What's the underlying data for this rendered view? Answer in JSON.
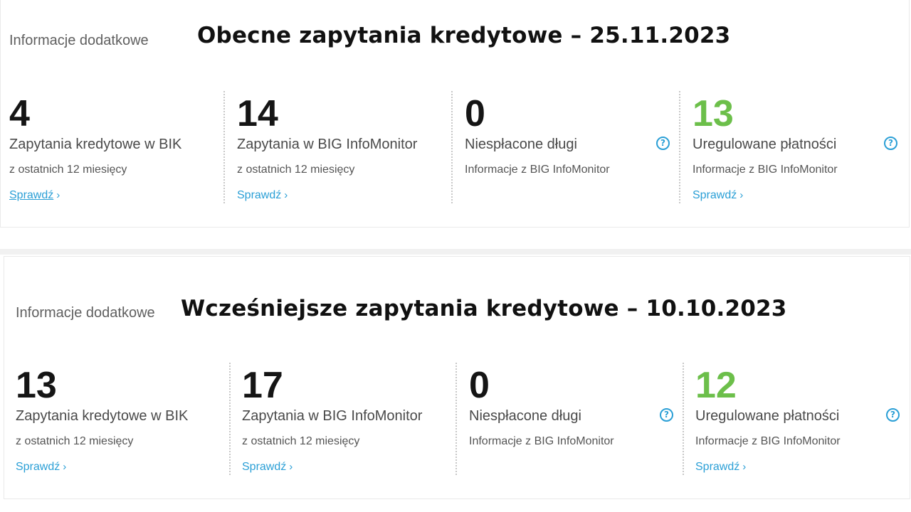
{
  "sections": [
    {
      "label": "Informacje dodatkowe",
      "title": "Obecne zapytania kredytowe – 25.11.2023",
      "stats": [
        {
          "value": "4",
          "label": "Zapytania kredytowe w BIK",
          "sub": "z ostatnich 12 miesięcy",
          "link": "Sprawdź"
        },
        {
          "value": "14",
          "label": "Zapytania w BIG InfoMonitor",
          "sub": "z ostatnich 12 miesięcy",
          "link": "Sprawdź"
        },
        {
          "value": "0",
          "label": "Niespłacone długi",
          "sub": "Informacje z BIG InfoMonitor",
          "help": "?"
        },
        {
          "value": "13",
          "label": "Uregulowane płatności",
          "sub": "Informacje z BIG InfoMonitor",
          "link": "Sprawdź",
          "help": "?"
        }
      ]
    },
    {
      "label": "Informacje dodatkowe",
      "title": "Wcześniejsze zapytania kredytowe – 10.10.2023",
      "stats": [
        {
          "value": "13",
          "label": "Zapytania kredytowe w BIK",
          "sub": "z ostatnich 12 miesięcy",
          "link": "Sprawdź"
        },
        {
          "value": "17",
          "label": "Zapytania w BIG InfoMonitor",
          "sub": "z ostatnich 12 miesięcy",
          "link": "Sprawdź"
        },
        {
          "value": "0",
          "label": "Niespłacone długi",
          "sub": "Informacje z BIG InfoMonitor",
          "help": "?"
        },
        {
          "value": "12",
          "label": "Uregulowane płatności",
          "sub": "Informacje z BIG InfoMonitor",
          "link": "Sprawdź",
          "help": "?"
        }
      ]
    }
  ],
  "icons": {
    "help": "question-circle-icon",
    "link_chevron": "chevron-right-icon"
  },
  "colors": {
    "positive_value": "#6cbf4a",
    "link": "#2a9fd6",
    "value": "#151515"
  }
}
